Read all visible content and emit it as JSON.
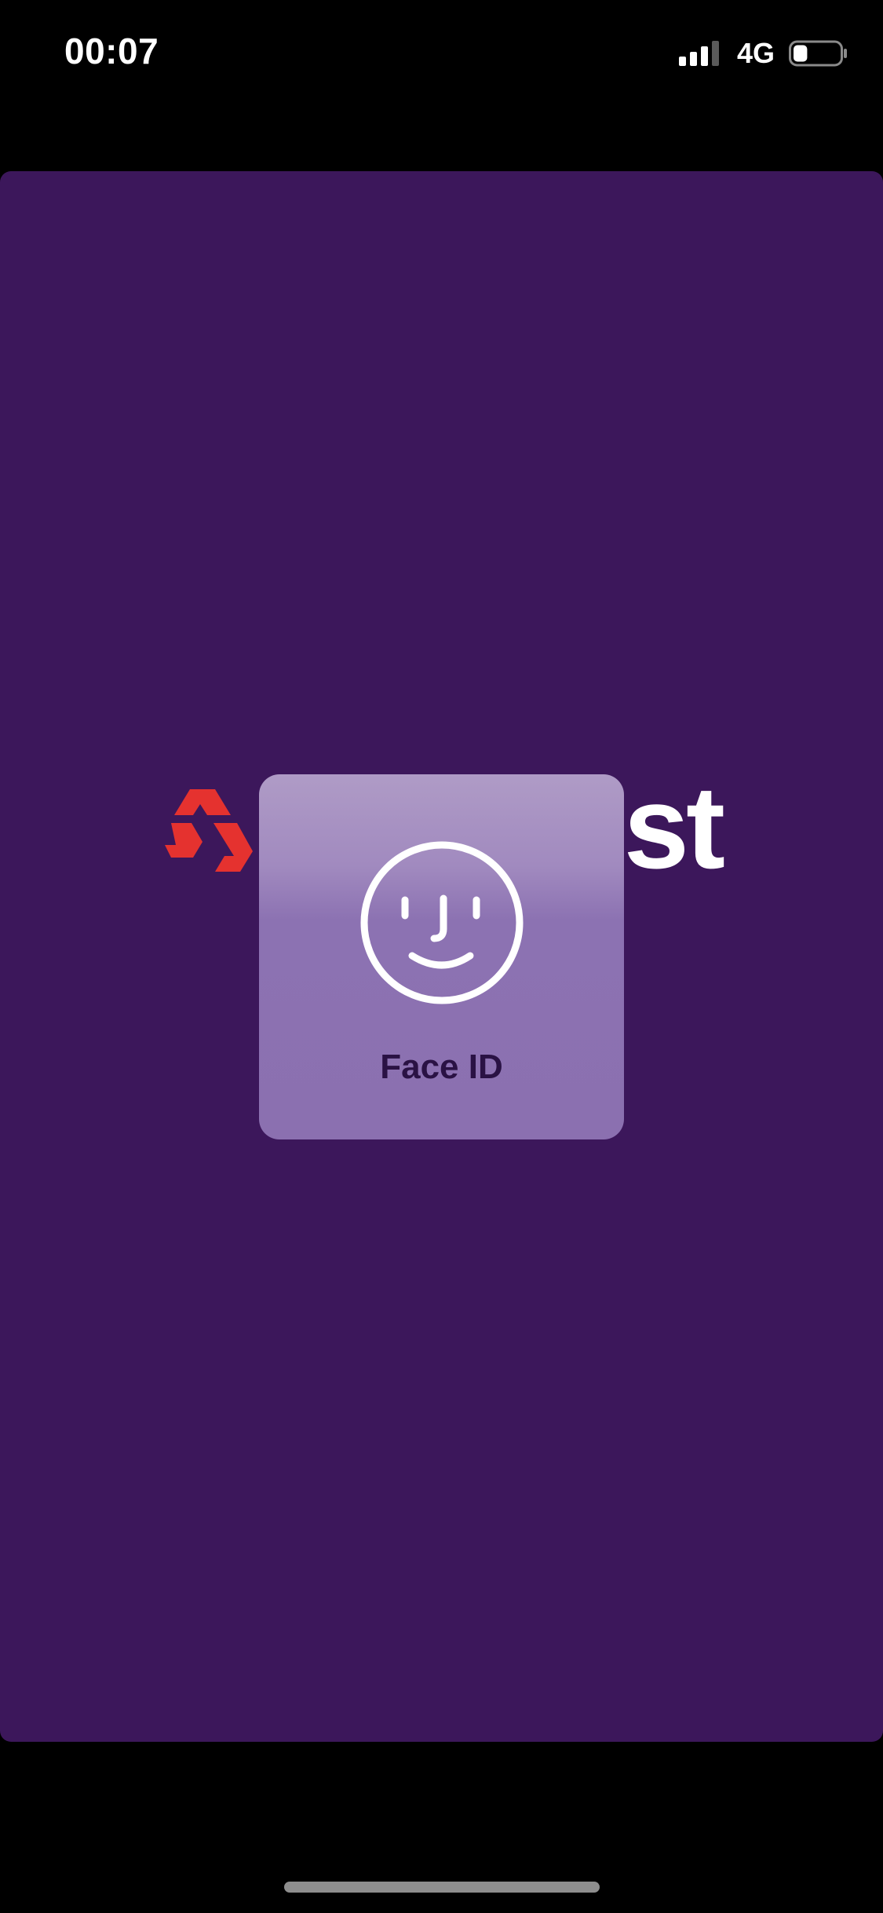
{
  "status_bar": {
    "time": "00:07",
    "network": "4G",
    "signal_icon": "cellular-signal-icon",
    "battery_icon": "battery-icon",
    "battery_level": 0.3
  },
  "app": {
    "logo_text": "st",
    "logo_icon": "natwest-chevrons-logo",
    "brand_color": "#3c175b",
    "logo_mark_color": "#e5322f"
  },
  "face_id": {
    "label": "Face ID",
    "icon": "face-id-icon"
  }
}
